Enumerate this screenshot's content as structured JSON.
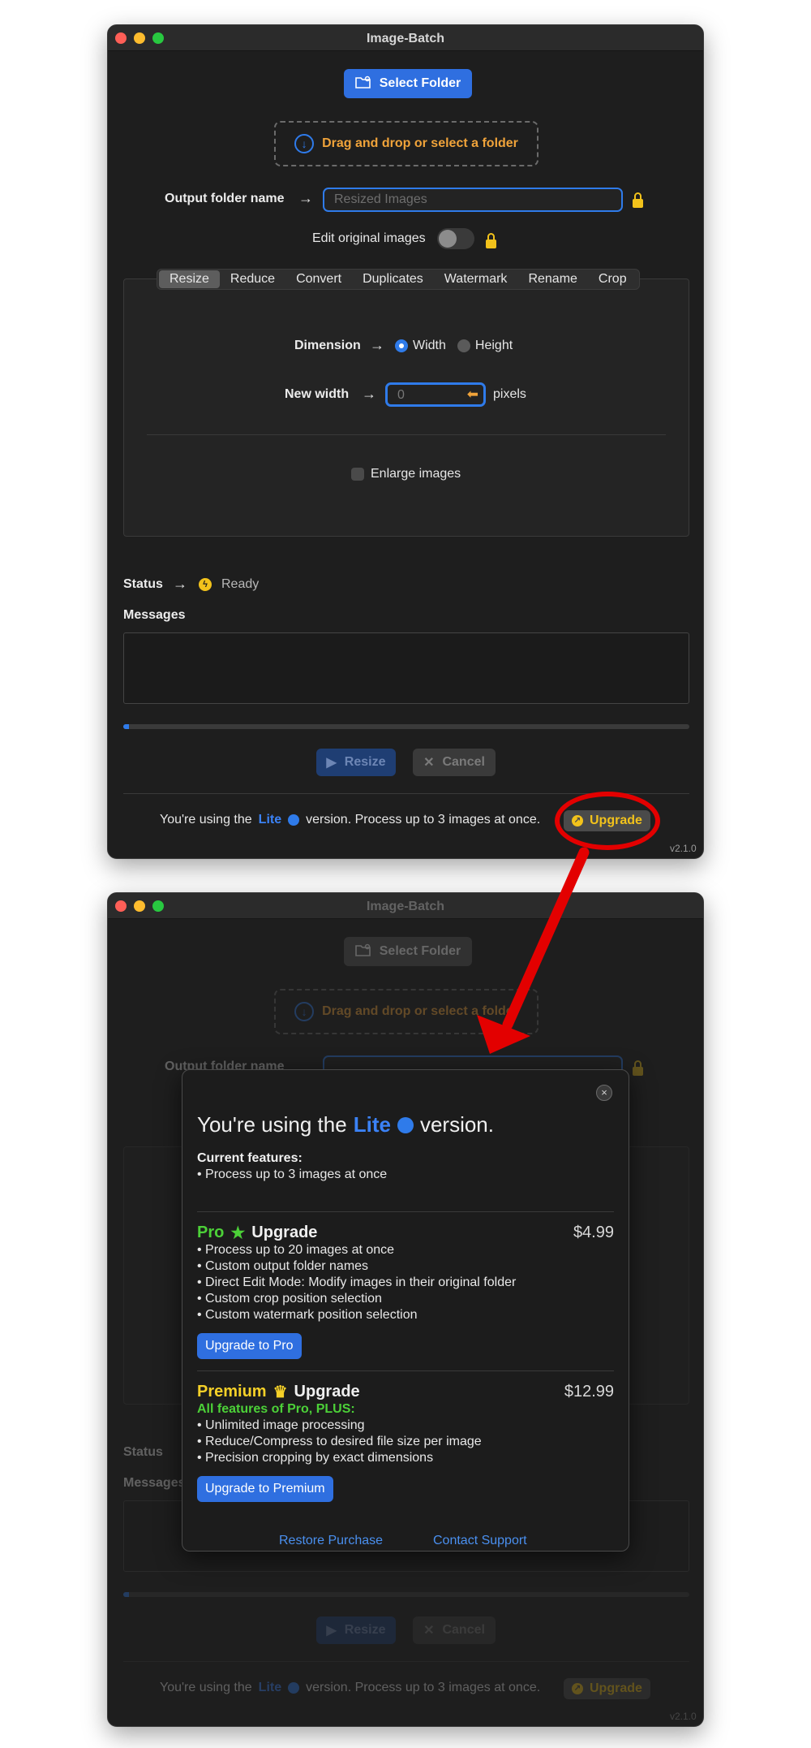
{
  "app": {
    "title": "Image-Batch",
    "select_folder": "Select Folder",
    "drop_text": "Drag and drop or select a folder",
    "output_label": "Output folder name",
    "output_placeholder": "Resized Images",
    "edit_original_label": "Edit original images",
    "tabs": [
      "Resize",
      "Reduce",
      "Convert",
      "Duplicates",
      "Watermark",
      "Rename",
      "Crop"
    ],
    "selected_tab": "Resize",
    "dimension_label": "Dimension",
    "radio_width": "Width",
    "radio_height": "Height",
    "new_width_label": "New width",
    "new_width_value": "0",
    "pixels_label": "pixels",
    "enlarge_label": "Enlarge images",
    "status_label": "Status",
    "status_value": "Ready",
    "messages_label": "Messages",
    "resize_button": "Resize",
    "cancel_button": "Cancel",
    "footer_prefix": "You're using the",
    "footer_lite": "Lite",
    "footer_suffix": "version. Process up to 3 images at once.",
    "upgrade_button": "Upgrade",
    "version": "v2.1.0"
  },
  "modal": {
    "title_prefix": "You're using the",
    "title_lite": "Lite",
    "title_suffix": "version.",
    "current_heading": "Current features:",
    "current_items": [
      "• Process up to 3 images at once"
    ],
    "pro_name": "Pro",
    "pro_upgrade": "Upgrade",
    "pro_price": "$4.99",
    "pro_items": [
      "• Process up to 20 images at once",
      "• Custom output folder names",
      "• Direct Edit Mode: Modify images in their original folder",
      "• Custom crop position selection",
      "• Custom watermark position selection"
    ],
    "pro_button": "Upgrade to Pro",
    "premium_name": "Premium",
    "premium_upgrade": "Upgrade",
    "premium_price": "$12.99",
    "premium_subheading": "All features of Pro, PLUS:",
    "premium_items": [
      "• Unlimited image processing",
      "• Reduce/Compress to desired file size per image",
      "• Precision cropping by exact dimensions"
    ],
    "premium_button": "Upgrade to Premium",
    "restore_link": "Restore Purchase",
    "support_link": "Contact Support",
    "close_icon": "×"
  },
  "colors": {
    "accent_blue": "#2f6fe0",
    "annotation_red": "#e30000",
    "upgrade_yellow": "#f2c21b",
    "pro_green": "#4cd138"
  },
  "progress_fraction": 0.01
}
